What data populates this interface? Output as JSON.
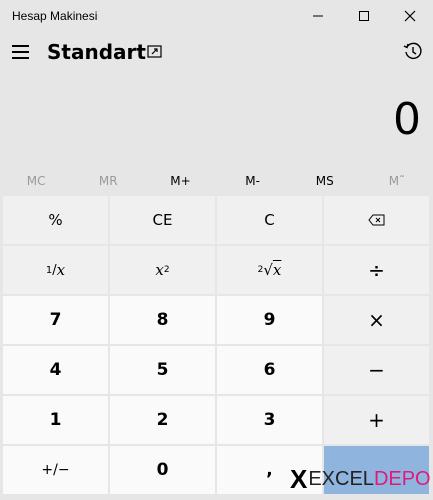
{
  "window": {
    "title": "Hesap Makinesi"
  },
  "header": {
    "mode": "Standart"
  },
  "display": {
    "value": "0"
  },
  "memory": [
    {
      "label": "MC",
      "enabled": false
    },
    {
      "label": "MR",
      "enabled": false
    },
    {
      "label": "M+",
      "enabled": true
    },
    {
      "label": "M-",
      "enabled": true
    },
    {
      "label": "MS",
      "enabled": true
    },
    {
      "label": "M˜",
      "enabled": false
    }
  ],
  "keys": {
    "percent": "%",
    "ce": "CE",
    "c": "C",
    "reciprocal_num": "1",
    "reciprocal_den": "x",
    "square_x": "x",
    "square_pow": "2",
    "sqrt_idx": "2",
    "sqrt_x": "x",
    "divide": "÷",
    "seven": "7",
    "eight": "8",
    "nine": "9",
    "multiply": "×",
    "four": "4",
    "five": "5",
    "six": "6",
    "minus": "−",
    "one": "1",
    "two": "2",
    "three": "3",
    "plus": "+",
    "negate": "+/−",
    "zero": "0",
    "decimal": ","
  },
  "watermark": {
    "x": "X",
    "excel": "EXCEL",
    "depo": "DEPO"
  },
  "colors": {
    "equals_bg": "#8fb4dd",
    "depo": "#e0197d"
  }
}
